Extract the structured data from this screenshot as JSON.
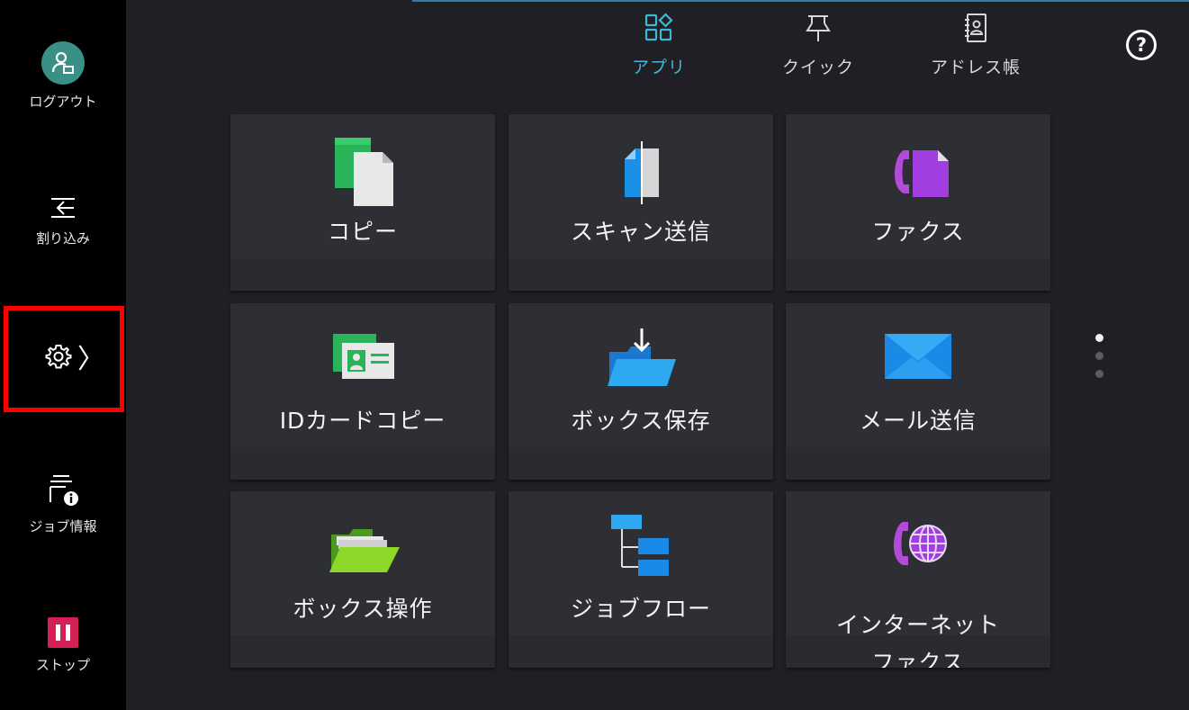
{
  "sidebar": {
    "logout_label": "ログアウト",
    "interrupt_label": "割り込み",
    "settings_chevron": "〉",
    "jobinfo_label": "ジョブ情報",
    "stop_label": "ストップ"
  },
  "tabs": [
    {
      "label": "アプリ",
      "icon": "apps-grid-icon",
      "selected": true
    },
    {
      "label": "クイック",
      "icon": "pin-icon",
      "selected": false
    },
    {
      "label": "アドレス帳",
      "icon": "address-book-icon",
      "selected": false
    }
  ],
  "help": {
    "symbol": "?"
  },
  "apps": [
    {
      "label": "コピー",
      "icon": "copy-icon"
    },
    {
      "label": "スキャン送信",
      "icon": "scan-send-icon"
    },
    {
      "label": "ファクス",
      "icon": "fax-icon"
    },
    {
      "label": "IDカードコピー",
      "icon": "id-card-copy-icon"
    },
    {
      "label": "ボックス保存",
      "icon": "box-save-icon"
    },
    {
      "label": "メール送信",
      "icon": "mail-send-icon"
    },
    {
      "label": "ボックス操作",
      "icon": "box-operation-icon"
    },
    {
      "label": "ジョブフロー",
      "icon": "job-flow-icon"
    },
    {
      "label_line1": "インターネット",
      "label_line2": "ファクス",
      "icon": "internet-fax-icon"
    }
  ],
  "pager": {
    "pages": 3,
    "current": 1
  },
  "colors": {
    "accent": "#3fb8d8",
    "highlight_border": "#ff0000",
    "stop": "#d42054",
    "logout_avatar": "#3a8f86"
  }
}
